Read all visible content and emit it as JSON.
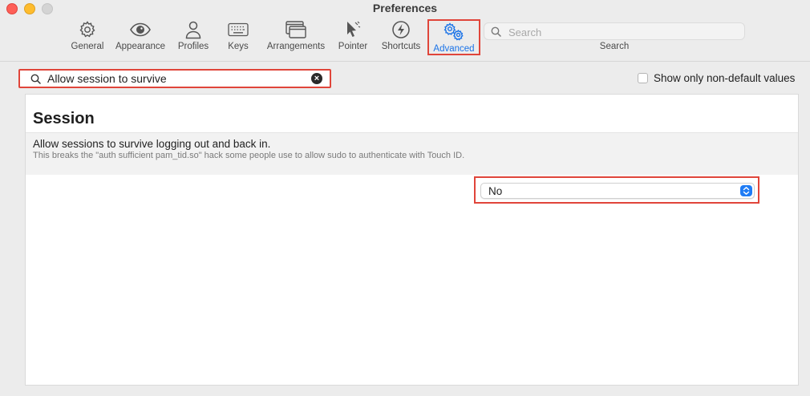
{
  "window": {
    "title": "Preferences"
  },
  "toolbar": {
    "items": [
      {
        "label": "General",
        "icon": "gear-icon"
      },
      {
        "label": "Appearance",
        "icon": "eye-icon"
      },
      {
        "label": "Profiles",
        "icon": "person-icon"
      },
      {
        "label": "Keys",
        "icon": "keyboard-icon"
      },
      {
        "label": "Arrangements",
        "icon": "windows-icon"
      },
      {
        "label": "Pointer",
        "icon": "cursor-icon"
      },
      {
        "label": "Shortcuts",
        "icon": "lightning-icon"
      },
      {
        "label": "Advanced",
        "icon": "gears-icon",
        "selected": true
      }
    ],
    "search": {
      "placeholder": "Search",
      "label": "Search"
    }
  },
  "filter": {
    "value": "Allow session to survive"
  },
  "options": {
    "non_default_label": "Show only non-default values",
    "non_default_checked": false
  },
  "section": {
    "title": "Session",
    "settings": [
      {
        "title": "Allow sessions to survive logging out and back in.",
        "description": "This breaks the \"auth sufficient pam_tid.so\" hack some people use to allow sudo to authenticate with Touch ID.",
        "value": "No"
      }
    ]
  },
  "colors": {
    "accent": "#1a73e8",
    "highlight": "#e0453a"
  }
}
